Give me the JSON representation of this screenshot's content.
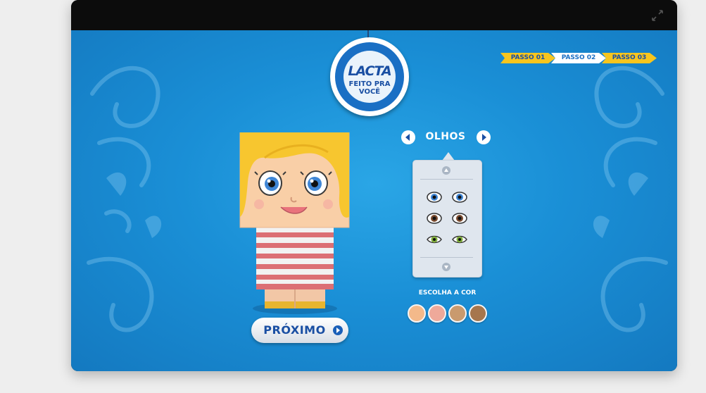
{
  "logo": {
    "brand": "LACTA",
    "tagline_line1": "FEITO PRA",
    "tagline_line2": "VOCÊ"
  },
  "steps": [
    {
      "label": "PASSO 01",
      "active": false
    },
    {
      "label": "PASSO 02",
      "active": true
    },
    {
      "label": "PASSO 03",
      "active": false
    }
  ],
  "category": {
    "title": "OLHOS"
  },
  "options": {
    "eye_colors": [
      "blue",
      "blue",
      "brown",
      "brown",
      "green",
      "green"
    ]
  },
  "color_picker": {
    "label": "ESCOLHA A COR",
    "swatches": [
      "#f3b98a",
      "#efa99a",
      "#c99a6e",
      "#a6764d"
    ]
  },
  "actions": {
    "next_label": "PRÓXIMO"
  },
  "colors": {
    "background": "#1a8fd6",
    "accent_yellow": "#f7c51e",
    "brand_blue": "#1a4fa3"
  }
}
